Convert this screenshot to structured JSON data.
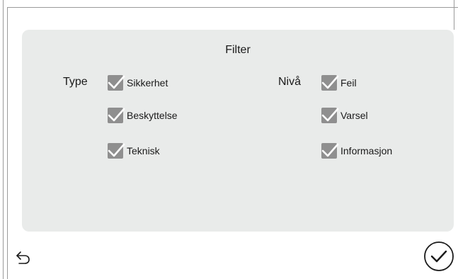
{
  "filter": {
    "title": "Filter",
    "type_group": {
      "label": "Type",
      "options": [
        {
          "label": "Sikkerhet",
          "checked": true
        },
        {
          "label": "Beskyttelse",
          "checked": true
        },
        {
          "label": "Teknisk",
          "checked": true
        }
      ]
    },
    "level_group": {
      "label": "Nivå",
      "options": [
        {
          "label": "Feil",
          "checked": true
        },
        {
          "label": "Varsel",
          "checked": true
        },
        {
          "label": "Informasjon",
          "checked": true
        }
      ]
    }
  },
  "footer": {
    "back_icon": "back-arrow-icon",
    "confirm_icon": "circle-check-icon"
  },
  "colors": {
    "panel_bg": "#e9ebea",
    "checkbox_bg": "#8f8f8f",
    "check_stroke": "#ffffff",
    "border": "#9a9a9a"
  }
}
